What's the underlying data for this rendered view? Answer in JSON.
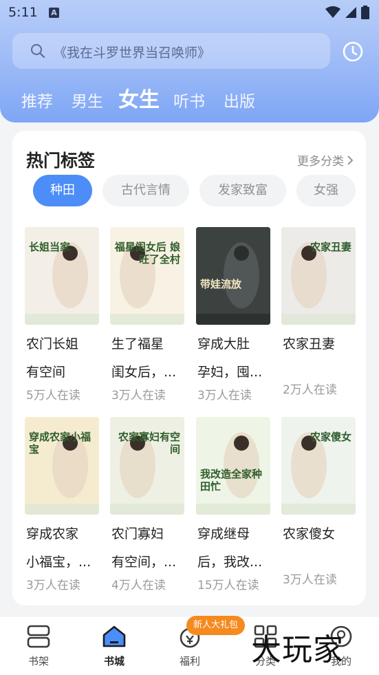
{
  "status_bar": {
    "time": "5:11",
    "notification_letter": "A"
  },
  "search": {
    "placeholder": "《我在斗罗世界当召唤师》"
  },
  "tabs": [
    {
      "label": "推荐",
      "active": false
    },
    {
      "label": "男生",
      "active": false
    },
    {
      "label": "女生",
      "active": true
    },
    {
      "label": "听书",
      "active": false
    },
    {
      "label": "出版",
      "active": false
    }
  ],
  "hot_tags": {
    "title": "热门标签",
    "more_label": "更多分类",
    "chips": [
      {
        "label": "种田",
        "active": true
      },
      {
        "label": "古代言情",
        "active": false
      },
      {
        "label": "发家致富",
        "active": false
      },
      {
        "label": "女强",
        "active": false
      }
    ]
  },
  "books": [
    {
      "title_line1": "农门长姐",
      "title_line2": "有空间",
      "readers": "5万人在读",
      "cover_text": "长姐当家",
      "cover_color": "#f3efe7"
    },
    {
      "title_line1": "生了福星",
      "title_line2": "闺女后，...",
      "readers": "3万人在读",
      "cover_text": "福星闺女后 娘旺了全村",
      "cover_color": "#f7f2e3"
    },
    {
      "title_line1": "穿成大肚",
      "title_line2": "孕妇，囤...",
      "readers": "3万人在读",
      "cover_text": "带娃流放",
      "cover_color": "#3b4240"
    },
    {
      "title_line1": "农家丑妻",
      "title_line2": "",
      "readers": "2万人在读",
      "cover_text": "农家丑妻",
      "cover_color": "#ecebe8"
    },
    {
      "title_line1": "穿成农家",
      "title_line2": "小福宝，...",
      "readers": "3万人在读",
      "cover_text": "穿成农家小福宝",
      "cover_color": "#f5ecd0"
    },
    {
      "title_line1": "农门寡妇",
      "title_line2": "有空间，...",
      "readers": "4万人在读",
      "cover_text": "农家寡妇有空间",
      "cover_color": "#eef0e4"
    },
    {
      "title_line1": "穿成继母",
      "title_line2": "后，我改...",
      "readers": "15万人在读",
      "cover_text": "我改造全家种田忙",
      "cover_color": "#eef5e6"
    },
    {
      "title_line1": "农家傻女",
      "title_line2": "",
      "readers": "3万人在读",
      "cover_text": "农家傻女",
      "cover_color": "#eef3ee"
    }
  ],
  "bottom_nav": {
    "badge": "新人大礼包",
    "items": [
      {
        "label": "书架",
        "icon": "bookshelf-icon",
        "active": false
      },
      {
        "label": "书城",
        "icon": "bookstore-icon",
        "active": true
      },
      {
        "label": "福利",
        "icon": "gift-icon",
        "active": false
      },
      {
        "label": "分类",
        "icon": "grid-icon",
        "active": false
      },
      {
        "label": "我的",
        "icon": "user-icon",
        "active": false
      }
    ]
  },
  "watermark": "大玩家",
  "colors": {
    "accent": "#4c8df7",
    "badge": "#f58a1f",
    "header_top": "#b7cdf8",
    "header_bottom": "#7ea6f5"
  }
}
